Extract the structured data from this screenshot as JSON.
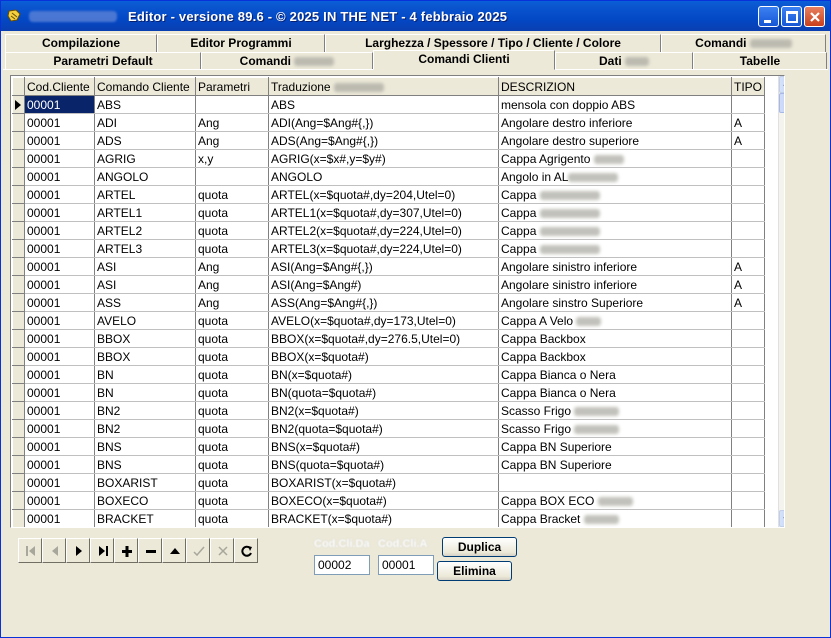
{
  "window": {
    "title": "Editor - versione 89.6 - © 2025  IN THE NET - 4 febbraio 2025"
  },
  "tabs": {
    "row1": [
      "Compilazione",
      "Editor Programmi",
      "Larghezza / Spessore / Tipo / Cliente / Colore",
      "Comandi"
    ],
    "row2": [
      "Parametri Default",
      "Comandi",
      "Comandi Clienti",
      "Dati",
      "Tabelle"
    ]
  },
  "grid": {
    "columns": [
      "Cod.Cliente",
      "Comando Cliente",
      "Parametri",
      "Traduzione",
      "DESCRIZION",
      "TIPO"
    ],
    "rows": [
      [
        "00001",
        "ABS",
        "",
        "ABS",
        "mensola con doppio ABS",
        ""
      ],
      [
        "00001",
        "ADI",
        "Ang",
        "ADI(Ang=$Ang#{,})",
        "Angolare destro inferiore",
        "A"
      ],
      [
        "00001",
        "ADS",
        "Ang",
        "ADS(Ang=$Ang#{,})",
        "Angolare destro superiore",
        "A"
      ],
      [
        "00001",
        "AGRIG",
        "x,y",
        "AGRIG(x=$x#,y=$y#)",
        "Cappa Agrigento",
        ""
      ],
      [
        "00001",
        "ANGOLO",
        "",
        "ANGOLO",
        "Angolo in AL",
        ""
      ],
      [
        "00001",
        "ARTEL",
        "quota",
        "ARTEL(x=$quota#,dy=204,Utel=0)",
        "Cappa",
        ""
      ],
      [
        "00001",
        "ARTEL1",
        "quota",
        "ARTEL1(x=$quota#,dy=307,Utel=0)",
        "Cappa",
        ""
      ],
      [
        "00001",
        "ARTEL2",
        "quota",
        "ARTEL2(x=$quota#,dy=224,Utel=0)",
        "Cappa",
        ""
      ],
      [
        "00001",
        "ARTEL3",
        "quota",
        "ARTEL3(x=$quota#,dy=224,Utel=0)",
        "Cappa",
        ""
      ],
      [
        "00001",
        "ASI",
        "Ang",
        "ASI(Ang=$Ang#{,})",
        "Angolare sinistro inferiore",
        "A"
      ],
      [
        "00001",
        "ASI",
        "Ang",
        "ASI(Ang=$Ang#)",
        "Angolare sinistro inferiore",
        "A"
      ],
      [
        "00001",
        "ASS",
        "Ang",
        "ASS(Ang=$Ang#{,})",
        "Angolare sinstro Superiore",
        "A"
      ],
      [
        "00001",
        "AVELO",
        "quota",
        "AVELO(x=$quota#,dy=173,Utel=0)",
        "Cappa A Velo",
        ""
      ],
      [
        "00001",
        "BBOX",
        "quota",
        "BBOX(x=$quota#,dy=276.5,Utel=0)",
        "Cappa Backbox",
        ""
      ],
      [
        "00001",
        "BBOX",
        "quota",
        "BBOX(x=$quota#)",
        "Cappa Backbox",
        ""
      ],
      [
        "00001",
        "BN",
        "quota",
        "BN(x=$quota#)",
        "Cappa Bianca o Nera",
        ""
      ],
      [
        "00001",
        "BN",
        "quota",
        "BN(quota=$quota#)",
        "Cappa Bianca o Nera",
        ""
      ],
      [
        "00001",
        "BN2",
        "quota",
        "BN2(x=$quota#)",
        "Scasso Frigo",
        ""
      ],
      [
        "00001",
        "BN2",
        "quota",
        "BN2(quota=$quota#)",
        "Scasso Frigo",
        ""
      ],
      [
        "00001",
        "BNS",
        "quota",
        "BNS(x=$quota#)",
        "Cappa BN Superiore",
        ""
      ],
      [
        "00001",
        "BNS",
        "quota",
        "BNS(quota=$quota#)",
        "Cappa BN Superiore",
        ""
      ],
      [
        "00001",
        "BOXARIST",
        "quota",
        "BOXARIST(x=$quota#)",
        "",
        ""
      ],
      [
        "00001",
        "BOXECO",
        "quota",
        "BOXECO(x=$quota#)",
        "Cappa BOX ECO",
        ""
      ],
      [
        "00001",
        "BRACKET",
        "quota",
        "BRACKET(x=$quota#)",
        "Cappa Bracket",
        ""
      ]
    ]
  },
  "filter": {
    "label_from": "Cod.Cli.Da",
    "label_to": "Cod.Cli.A",
    "from_value": "00002",
    "to_value": "00001"
  },
  "buttons": {
    "duplica": "Duplica",
    "elimina": "Elimina"
  },
  "icons": {
    "nav": [
      "first-record-icon",
      "prior-record-icon",
      "next-record-icon",
      "last-record-icon",
      "insert-record-icon",
      "delete-record-icon",
      "edit-record-icon",
      "post-record-icon",
      "cancel-record-icon",
      "refresh-icon"
    ]
  }
}
